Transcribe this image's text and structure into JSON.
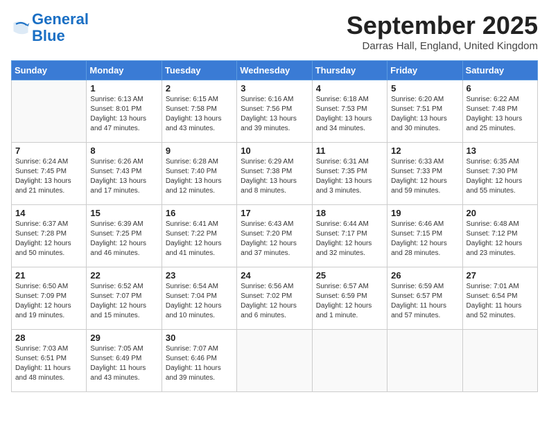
{
  "logo": {
    "line1": "General",
    "line2": "Blue"
  },
  "title": "September 2025",
  "location": "Darras Hall, England, United Kingdom",
  "days_of_week": [
    "Sunday",
    "Monday",
    "Tuesday",
    "Wednesday",
    "Thursday",
    "Friday",
    "Saturday"
  ],
  "weeks": [
    [
      {
        "day": "",
        "info": ""
      },
      {
        "day": "1",
        "info": "Sunrise: 6:13 AM\nSunset: 8:01 PM\nDaylight: 13 hours\nand 47 minutes."
      },
      {
        "day": "2",
        "info": "Sunrise: 6:15 AM\nSunset: 7:58 PM\nDaylight: 13 hours\nand 43 minutes."
      },
      {
        "day": "3",
        "info": "Sunrise: 6:16 AM\nSunset: 7:56 PM\nDaylight: 13 hours\nand 39 minutes."
      },
      {
        "day": "4",
        "info": "Sunrise: 6:18 AM\nSunset: 7:53 PM\nDaylight: 13 hours\nand 34 minutes."
      },
      {
        "day": "5",
        "info": "Sunrise: 6:20 AM\nSunset: 7:51 PM\nDaylight: 13 hours\nand 30 minutes."
      },
      {
        "day": "6",
        "info": "Sunrise: 6:22 AM\nSunset: 7:48 PM\nDaylight: 13 hours\nand 25 minutes."
      }
    ],
    [
      {
        "day": "7",
        "info": "Sunrise: 6:24 AM\nSunset: 7:45 PM\nDaylight: 13 hours\nand 21 minutes."
      },
      {
        "day": "8",
        "info": "Sunrise: 6:26 AM\nSunset: 7:43 PM\nDaylight: 13 hours\nand 17 minutes."
      },
      {
        "day": "9",
        "info": "Sunrise: 6:28 AM\nSunset: 7:40 PM\nDaylight: 13 hours\nand 12 minutes."
      },
      {
        "day": "10",
        "info": "Sunrise: 6:29 AM\nSunset: 7:38 PM\nDaylight: 13 hours\nand 8 minutes."
      },
      {
        "day": "11",
        "info": "Sunrise: 6:31 AM\nSunset: 7:35 PM\nDaylight: 13 hours\nand 3 minutes."
      },
      {
        "day": "12",
        "info": "Sunrise: 6:33 AM\nSunset: 7:33 PM\nDaylight: 12 hours\nand 59 minutes."
      },
      {
        "day": "13",
        "info": "Sunrise: 6:35 AM\nSunset: 7:30 PM\nDaylight: 12 hours\nand 55 minutes."
      }
    ],
    [
      {
        "day": "14",
        "info": "Sunrise: 6:37 AM\nSunset: 7:28 PM\nDaylight: 12 hours\nand 50 minutes."
      },
      {
        "day": "15",
        "info": "Sunrise: 6:39 AM\nSunset: 7:25 PM\nDaylight: 12 hours\nand 46 minutes."
      },
      {
        "day": "16",
        "info": "Sunrise: 6:41 AM\nSunset: 7:22 PM\nDaylight: 12 hours\nand 41 minutes."
      },
      {
        "day": "17",
        "info": "Sunrise: 6:43 AM\nSunset: 7:20 PM\nDaylight: 12 hours\nand 37 minutes."
      },
      {
        "day": "18",
        "info": "Sunrise: 6:44 AM\nSunset: 7:17 PM\nDaylight: 12 hours\nand 32 minutes."
      },
      {
        "day": "19",
        "info": "Sunrise: 6:46 AM\nSunset: 7:15 PM\nDaylight: 12 hours\nand 28 minutes."
      },
      {
        "day": "20",
        "info": "Sunrise: 6:48 AM\nSunset: 7:12 PM\nDaylight: 12 hours\nand 23 minutes."
      }
    ],
    [
      {
        "day": "21",
        "info": "Sunrise: 6:50 AM\nSunset: 7:09 PM\nDaylight: 12 hours\nand 19 minutes."
      },
      {
        "day": "22",
        "info": "Sunrise: 6:52 AM\nSunset: 7:07 PM\nDaylight: 12 hours\nand 15 minutes."
      },
      {
        "day": "23",
        "info": "Sunrise: 6:54 AM\nSunset: 7:04 PM\nDaylight: 12 hours\nand 10 minutes."
      },
      {
        "day": "24",
        "info": "Sunrise: 6:56 AM\nSunset: 7:02 PM\nDaylight: 12 hours\nand 6 minutes."
      },
      {
        "day": "25",
        "info": "Sunrise: 6:57 AM\nSunset: 6:59 PM\nDaylight: 12 hours\nand 1 minute."
      },
      {
        "day": "26",
        "info": "Sunrise: 6:59 AM\nSunset: 6:57 PM\nDaylight: 11 hours\nand 57 minutes."
      },
      {
        "day": "27",
        "info": "Sunrise: 7:01 AM\nSunset: 6:54 PM\nDaylight: 11 hours\nand 52 minutes."
      }
    ],
    [
      {
        "day": "28",
        "info": "Sunrise: 7:03 AM\nSunset: 6:51 PM\nDaylight: 11 hours\nand 48 minutes."
      },
      {
        "day": "29",
        "info": "Sunrise: 7:05 AM\nSunset: 6:49 PM\nDaylight: 11 hours\nand 43 minutes."
      },
      {
        "day": "30",
        "info": "Sunrise: 7:07 AM\nSunset: 6:46 PM\nDaylight: 11 hours\nand 39 minutes."
      },
      {
        "day": "",
        "info": ""
      },
      {
        "day": "",
        "info": ""
      },
      {
        "day": "",
        "info": ""
      },
      {
        "day": "",
        "info": ""
      }
    ]
  ]
}
